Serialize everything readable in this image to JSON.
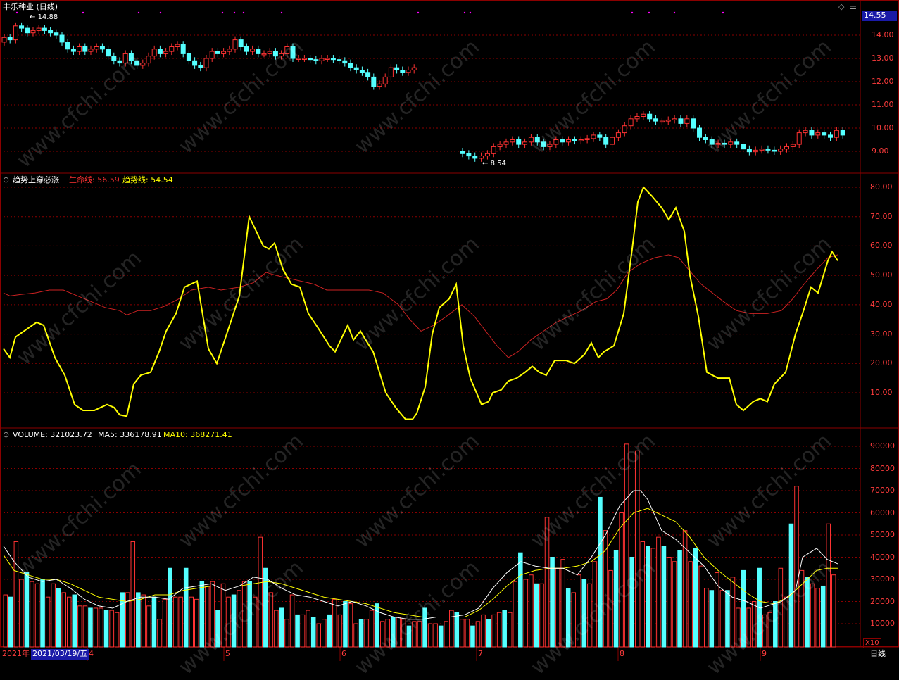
{
  "header": {
    "stock_title": "丰乐种业 (日线)",
    "high_marker": "14.88",
    "low_marker": "8.54",
    "current_price": "14.55"
  },
  "price_axis": [
    "14.00",
    "13.00",
    "12.00",
    "11.00",
    "10.00",
    "9.00"
  ],
  "indicator": {
    "name": "趋势上穿必涨",
    "line1_label": "生命线:",
    "line1_value": "56.59",
    "line2_label": "趋势线:",
    "line2_value": "54.54",
    "axis": [
      "80.00",
      "70.00",
      "60.00",
      "50.00",
      "40.00",
      "30.00",
      "20.00",
      "10.00"
    ]
  },
  "volume": {
    "label": "VOLUME:",
    "value": "321023.72",
    "ma5_label": "MA5:",
    "ma5_value": "336178.91",
    "ma10_label": "MA10:",
    "ma10_value": "368271.41",
    "axis": [
      "90000",
      "80000",
      "70000",
      "60000",
      "50000",
      "40000",
      "30000",
      "20000",
      "10000"
    ],
    "multiplier": "X10"
  },
  "time_axis": {
    "year": "2021年",
    "cursor_date": "2021/03/19/五",
    "months": [
      "4",
      "5",
      "6",
      "7",
      "8",
      "9"
    ],
    "period": "日线"
  },
  "watermark": "www.cfchi.com",
  "colors": {
    "up": "#ff3232",
    "down": "#54ffff",
    "trend": "#ffff00",
    "life": "#cc2222",
    "grid": "#8b0000",
    "axis_text": "#ff3c3c",
    "cursor_box": "#1a1aa8"
  }
}
